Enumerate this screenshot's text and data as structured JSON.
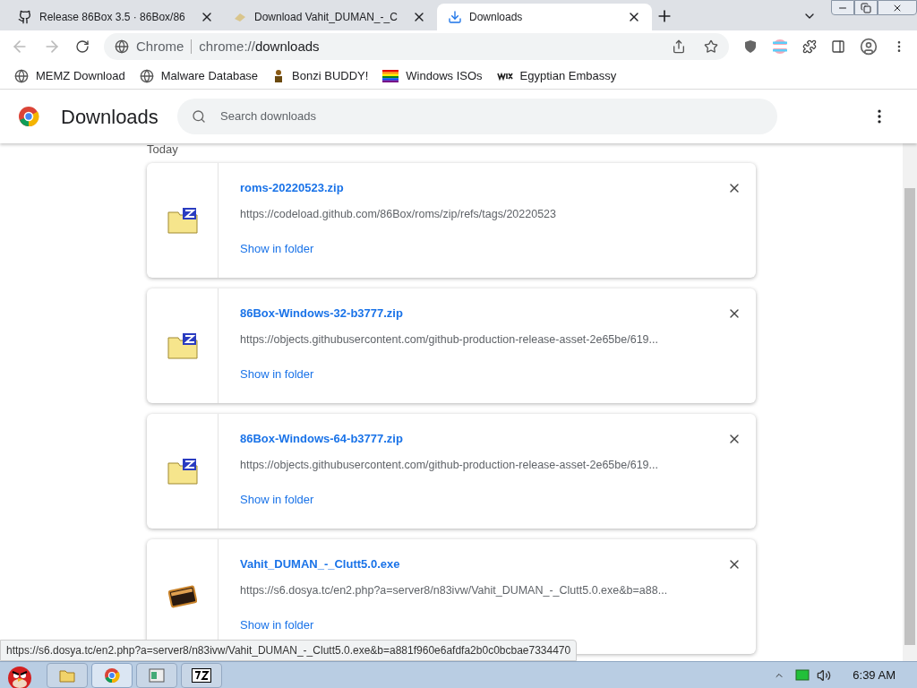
{
  "tabs": [
    {
      "title": "Release 86Box 3.5 · 86Box/86",
      "kind": "github",
      "selected": false
    },
    {
      "title": "Download Vahit_DUMAN_-_C",
      "kind": "page",
      "selected": false
    },
    {
      "title": "Downloads",
      "kind": "download",
      "selected": true
    }
  ],
  "omnibox": {
    "chip": "Chrome",
    "url_prefix": "chrome://",
    "url_host": "downloads"
  },
  "bookmarks": [
    {
      "label": "MEMZ Download",
      "kind": "globe"
    },
    {
      "label": "Malware Database",
      "kind": "globe"
    },
    {
      "label": "Bonzi BUDDY!",
      "kind": "figure"
    },
    {
      "label": "Windows ISOs",
      "kind": "rainbow"
    },
    {
      "label": "Egyptian Embassy",
      "kind": "wix"
    }
  ],
  "header": {
    "title": "Downloads",
    "search": {
      "placeholder": "Search downloads"
    }
  },
  "section": "Today",
  "downloads": [
    {
      "name": "roms-20220523.zip",
      "url": "https://codeload.github.com/86Box/roms/zip/refs/tags/20220523",
      "action": "Show in folder",
      "kind": "archive"
    },
    {
      "name": "86Box-Windows-32-b3777.zip",
      "url": "https://objects.githubusercontent.com/github-production-release-asset-2e65be/619...",
      "action": "Show in folder",
      "kind": "archive"
    },
    {
      "name": "86Box-Windows-64-b3777.zip",
      "url": "https://objects.githubusercontent.com/github-production-release-asset-2e65be/619...",
      "action": "Show in folder",
      "kind": "archive"
    },
    {
      "name": "Vahit_DUMAN_-_Clutt5.0.exe",
      "url": "https://s6.dosya.tc/en2.php?a=server8/n83ivw/Vahit_DUMAN_-_Clutt5.0.exe&b=a88...",
      "action": "Show in folder",
      "kind": "exe"
    }
  ],
  "status_bubble": "https://s6.dosya.tc/en2.php?a=server8/n83ivw/Vahit_DUMAN_-_Clutt5.0.exe&b=a881f960e6afdfa2b0c0bcbae7334470",
  "taskbar": {
    "apps": [
      {
        "kind": "folder",
        "selected": false
      },
      {
        "kind": "chrome",
        "selected": true
      },
      {
        "kind": "window",
        "selected": false
      },
      {
        "kind": "sevenzip",
        "selected": false
      }
    ],
    "time": "6:39 AM"
  }
}
